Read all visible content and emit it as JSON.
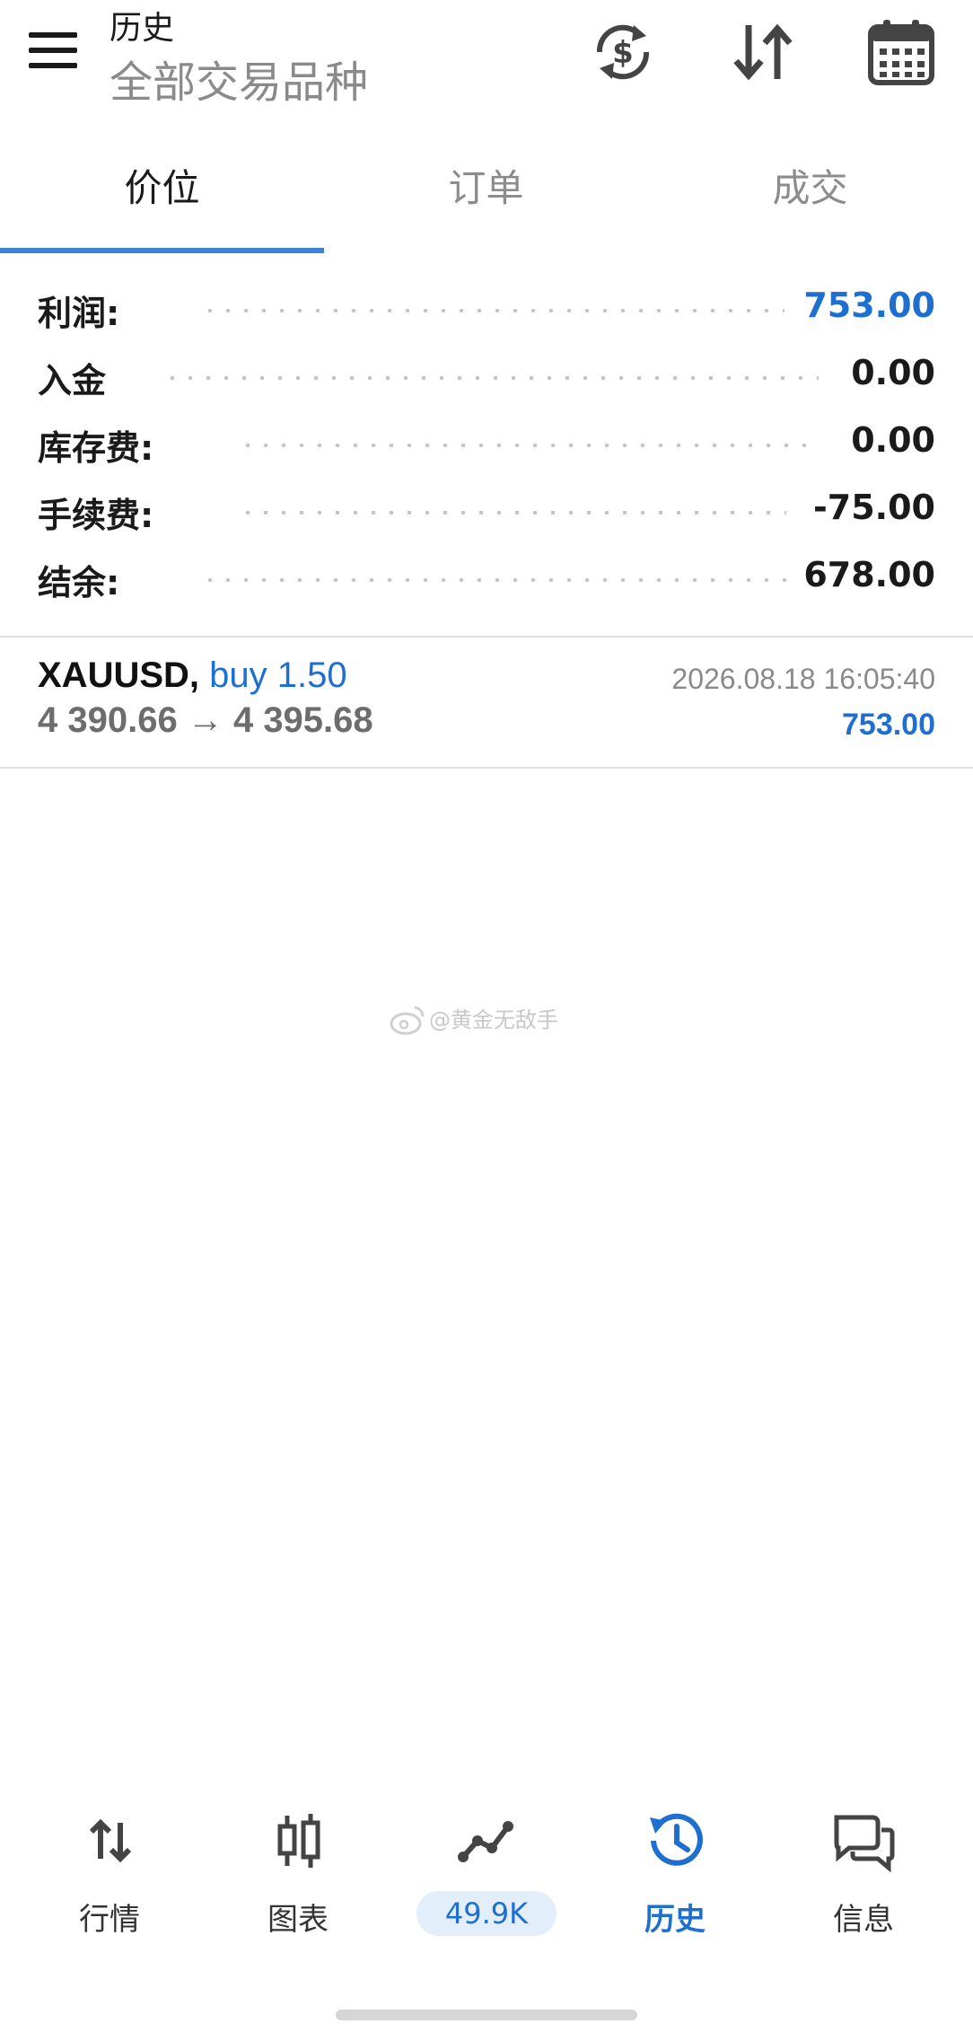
{
  "header": {
    "title": "历史",
    "subtitle": "全部交易品种",
    "icons": [
      "menu-icon",
      "currency-exchange-icon",
      "sort-icon",
      "calendar-icon"
    ]
  },
  "tabs": [
    {
      "label": "价位",
      "active": true
    },
    {
      "label": "订单",
      "active": false
    },
    {
      "label": "成交",
      "active": false
    }
  ],
  "summary": [
    {
      "label": "利润:",
      "value": "753.00",
      "highlight": true
    },
    {
      "label": "入金",
      "value": "0.00",
      "highlight": false
    },
    {
      "label": "库存费:",
      "value": "0.00",
      "highlight": false
    },
    {
      "label": "手续费:",
      "value": "-75.00",
      "highlight": false
    },
    {
      "label": "结余:",
      "value": "678.00",
      "highlight": false
    }
  ],
  "trade": {
    "symbol": "XAUUSD,",
    "side": "buy 1.50",
    "open_price": "4 390.66",
    "arrow": "→",
    "close_price": "4 395.68",
    "time": "2026.08.18 16:05:40",
    "profit": "753.00"
  },
  "watermark": "@黄金无敌手",
  "bottom_nav": [
    {
      "label": "行情",
      "icon": "quotes-arrows-icon",
      "active": false
    },
    {
      "label": "图表",
      "icon": "candlestick-chart-icon",
      "active": false
    },
    {
      "label": "49.9K",
      "icon": "trade-line-icon",
      "active": false,
      "badge": true
    },
    {
      "label": "历史",
      "icon": "history-clock-icon",
      "active": true
    },
    {
      "label": "信息",
      "icon": "messages-icon",
      "active": false
    }
  ],
  "colors": {
    "accent": "#1f6fd0",
    "tab_indicator": "#3b82d6",
    "muted": "#8a8a8a"
  }
}
